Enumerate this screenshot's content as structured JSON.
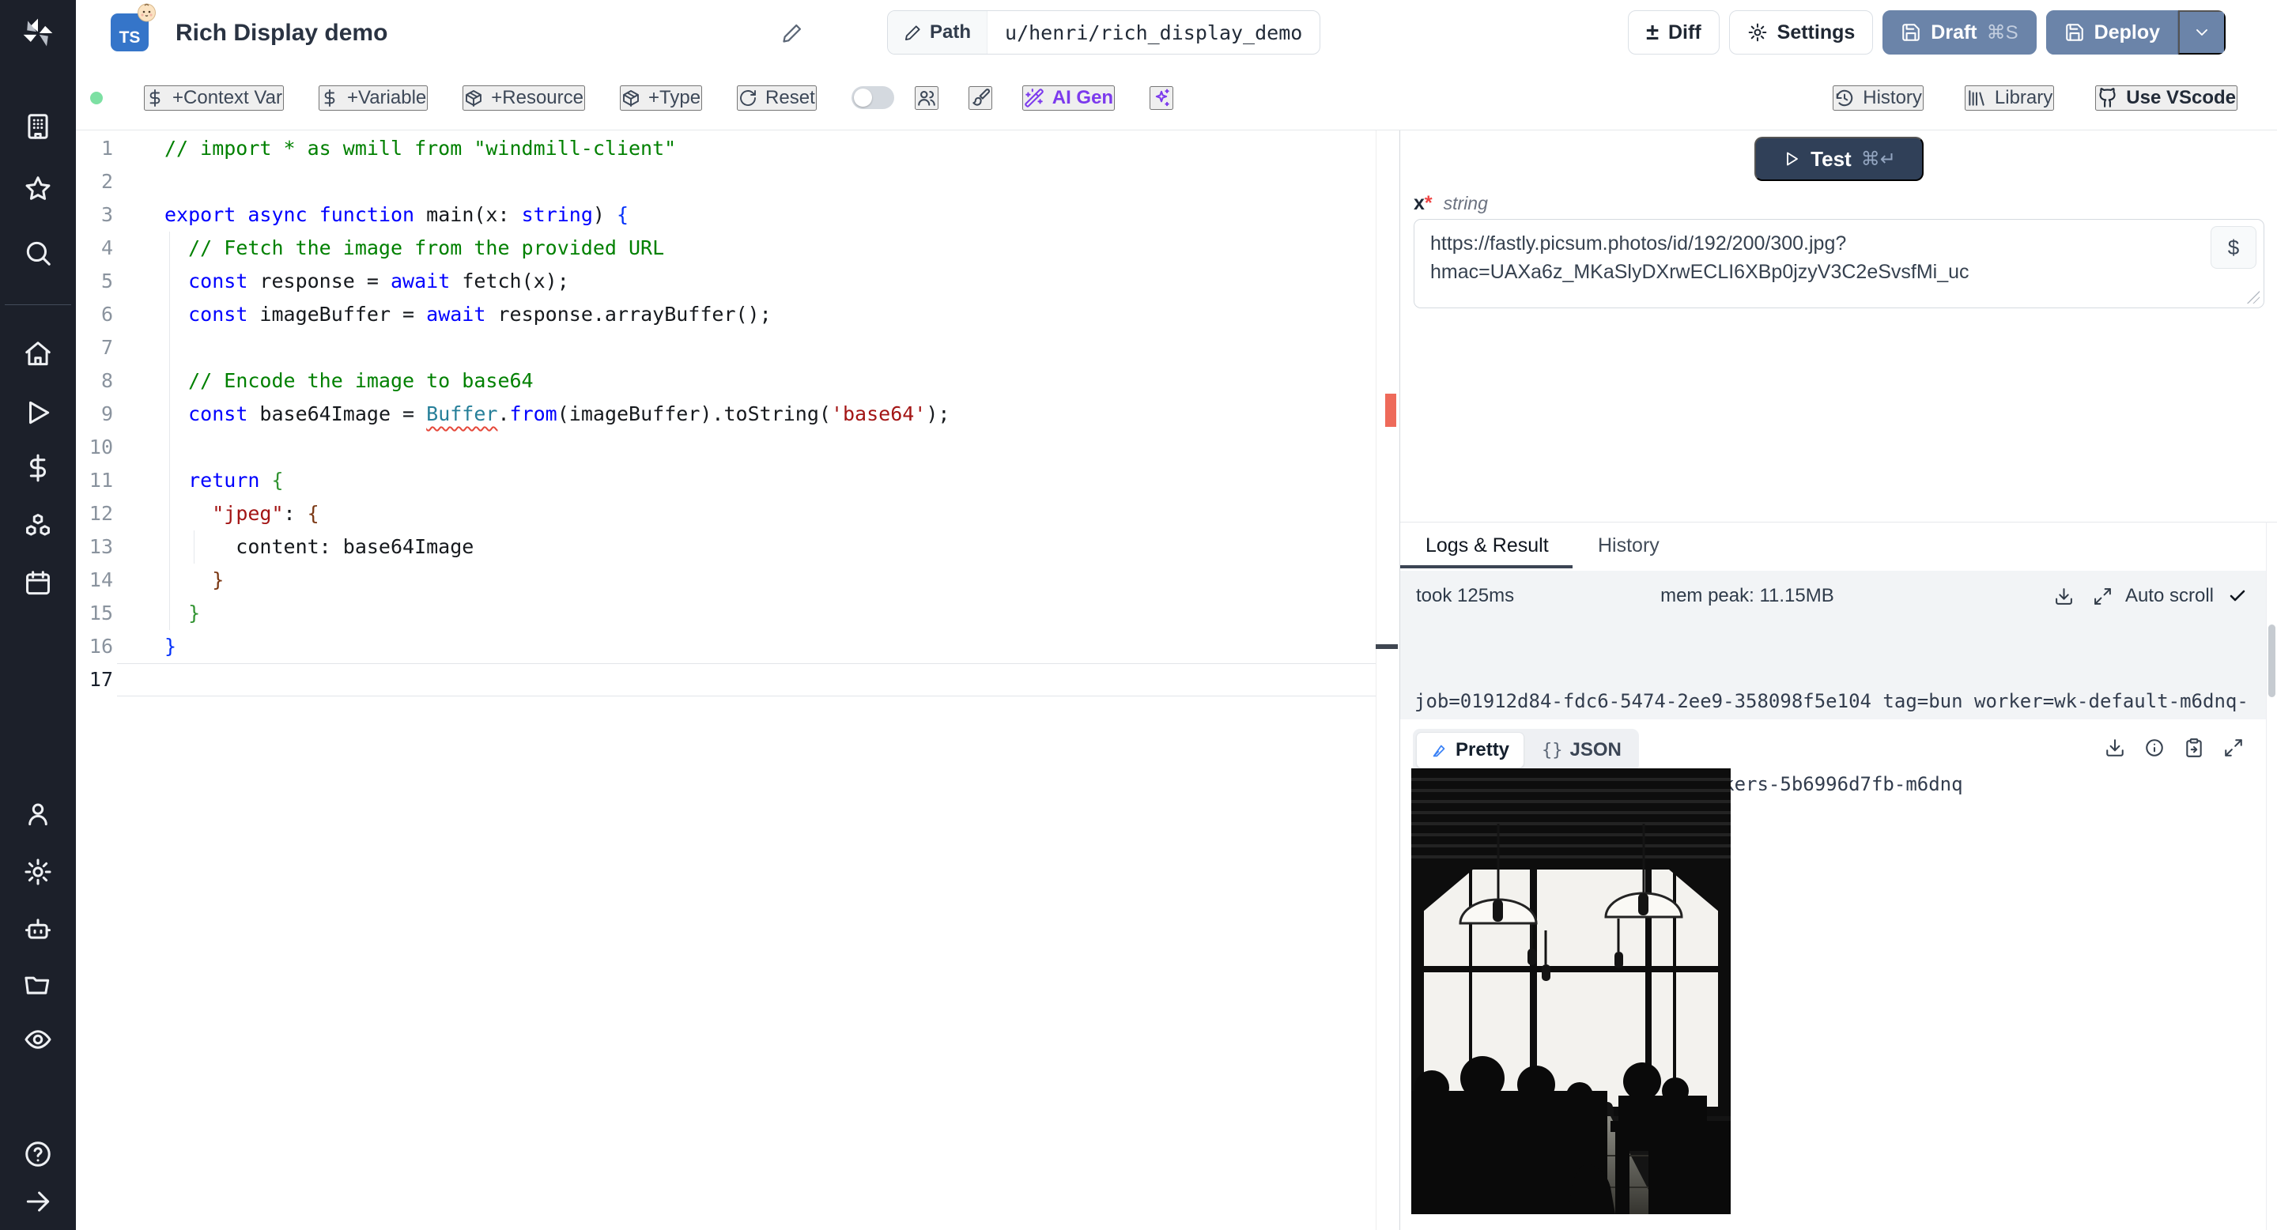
{
  "header": {
    "language_badge": "TS",
    "title": "Rich Display demo",
    "path_label": "Path",
    "path_value": "u/henri/rich_display_demo",
    "diff": "Diff",
    "settings": "Settings",
    "draft": "Draft",
    "draft_shortcut": "⌘S",
    "deploy": "Deploy"
  },
  "toolbar": {
    "context_var": "+Context Var",
    "variable": "+Variable",
    "resource": "+Resource",
    "type": "+Type",
    "reset": "Reset",
    "ai_gen": "AI Gen",
    "history": "History",
    "library": "Library",
    "use_vscode": "Use VScode"
  },
  "icons": {
    "diff_plus_minus": "±",
    "dollar": "$",
    "json_braces": "{}",
    "check": "✓"
  },
  "editor": {
    "active_line": 17,
    "lines": [
      {
        "n": 1,
        "seg": [
          [
            "cm",
            "// import * as wmill from \"windmill-client\""
          ]
        ]
      },
      {
        "n": 2,
        "seg": []
      },
      {
        "n": 3,
        "seg": [
          [
            "kw",
            "export"
          ],
          [
            "pl",
            " "
          ],
          [
            "kw",
            "async"
          ],
          [
            "pl",
            " "
          ],
          [
            "kw",
            "function"
          ],
          [
            "pl",
            " main(x: "
          ],
          [
            "kw",
            "string"
          ],
          [
            "pl",
            ") "
          ],
          [
            "b1",
            "{"
          ]
        ]
      },
      {
        "n": 4,
        "seg": [
          [
            "pl",
            "  "
          ],
          [
            "cm",
            "// Fetch the image from the provided URL"
          ]
        ]
      },
      {
        "n": 5,
        "seg": [
          [
            "pl",
            "  "
          ],
          [
            "kw",
            "const"
          ],
          [
            "pl",
            " response = "
          ],
          [
            "kw",
            "await"
          ],
          [
            "pl",
            " fetch(x);"
          ]
        ]
      },
      {
        "n": 6,
        "seg": [
          [
            "pl",
            "  "
          ],
          [
            "kw",
            "const"
          ],
          [
            "pl",
            " imageBuffer = "
          ],
          [
            "kw",
            "await"
          ],
          [
            "pl",
            " response.arrayBuffer();"
          ]
        ]
      },
      {
        "n": 7,
        "seg": []
      },
      {
        "n": 8,
        "seg": [
          [
            "pl",
            "  "
          ],
          [
            "cm",
            "// Encode the image to base64"
          ]
        ]
      },
      {
        "n": 9,
        "seg": [
          [
            "pl",
            "  "
          ],
          [
            "kw",
            "const"
          ],
          [
            "pl",
            " base64Image = "
          ],
          [
            "er",
            "Buffer"
          ],
          [
            "pl",
            "."
          ],
          [
            "kw",
            "from"
          ],
          [
            "pl",
            "(imageBuffer).toString("
          ],
          [
            "st",
            "'base64'"
          ],
          [
            "pl",
            ");"
          ]
        ]
      },
      {
        "n": 10,
        "seg": []
      },
      {
        "n": 11,
        "seg": [
          [
            "pl",
            "  "
          ],
          [
            "kw",
            "return"
          ],
          [
            "pl",
            " "
          ],
          [
            "b2",
            "{"
          ]
        ]
      },
      {
        "n": 12,
        "seg": [
          [
            "pl",
            "    "
          ],
          [
            "st",
            "\"jpeg\""
          ],
          [
            "pl",
            ": "
          ],
          [
            "b3",
            "{"
          ]
        ]
      },
      {
        "n": 13,
        "seg": [
          [
            "pl",
            "      content: base64Image"
          ]
        ]
      },
      {
        "n": 14,
        "seg": [
          [
            "pl",
            "    "
          ],
          [
            "b3",
            "}"
          ]
        ]
      },
      {
        "n": 15,
        "seg": [
          [
            "pl",
            "  "
          ],
          [
            "b2",
            "}"
          ]
        ]
      },
      {
        "n": 16,
        "seg": [
          [
            "b1",
            "}"
          ]
        ]
      },
      {
        "n": 17,
        "seg": []
      }
    ]
  },
  "run": {
    "test": "Test",
    "test_shortcut": "⌘↵",
    "arg_name": "x",
    "arg_required": "*",
    "arg_type": "string",
    "arg_value": "https://fastly.picsum.photos/id/192/200/300.jpg?hmac=UAXa6z_MKaSlyDXrwECLI6XBp0jzyV3C2eSvsfMi_uc",
    "arg_value_line1": "https://fastly.picsum.photos/id/192/200/300.jpg?",
    "arg_value_line2": "hmac=UAXa6z_MKaSlyDXrwECLI6XBp0jzyV3C2eSvsfMi_uc"
  },
  "logs": {
    "tab_logs": "Logs & Result",
    "tab_history": "History",
    "took": "took 125ms",
    "mem": "mem peak: 11.15MB",
    "auto_scroll": "Auto scroll",
    "log_line1": "job=01912d84-fdc6-5474-2ee9-358098f5e104 tag=bun worker=wk-default-m6dnq-",
    "log_line2": "HJEIL hostname=windmill-workers-5b6996d7fb-m6dnq"
  },
  "result": {
    "tab_pretty": "Pretty",
    "tab_json": "JSON"
  },
  "colors": {
    "accent_button_blue": "#6b84a9",
    "test_button_navy": "#304058",
    "ai_gen_purple": "#7c3aed",
    "status_dot_green": "#7de0a3",
    "error_marker_red": "#ee6a5a",
    "sidebar_dark": "#1c202a"
  }
}
